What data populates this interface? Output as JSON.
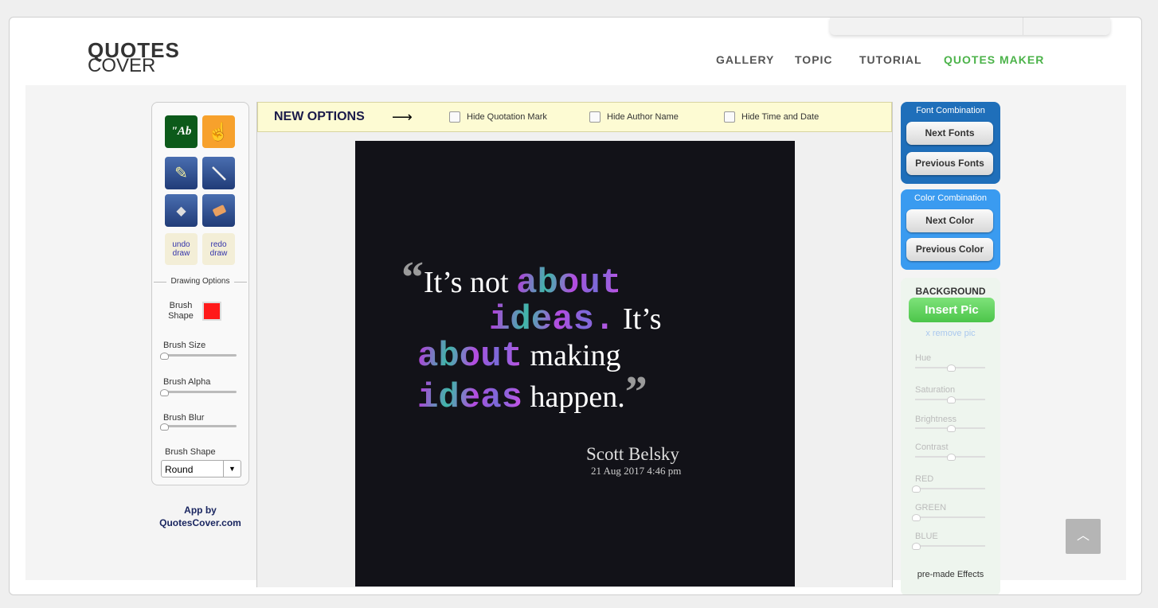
{
  "logo": {
    "line1": "QUOTES",
    "line2": "COVER"
  },
  "nav": [
    {
      "label": "GALLERY"
    },
    {
      "label": "TOPIC"
    },
    {
      "label": "TUTORIAL"
    },
    {
      "label": "QUOTES MAKER",
      "active": true
    }
  ],
  "tools": {
    "text_tool": "\"Ab",
    "undo": [
      "undo",
      "draw"
    ],
    "redo": [
      "redo",
      "draw"
    ]
  },
  "drawing": {
    "section": "Drawing Options",
    "brush_color_label": "Brush Shape",
    "brush_color": "#ff1a1a",
    "brush_size": "Brush Size",
    "brush_alpha": "Brush Alpha",
    "brush_blur": "Brush Blur",
    "brush_shape": "Brush Shape",
    "brush_shape_value": "Round"
  },
  "app_by": {
    "line1": "App by",
    "line2": "QuotesCover.com"
  },
  "options": {
    "title": "NEW OPTIONS",
    "hide_quote": "Hide Quotation Mark",
    "hide_author": "Hide Author Name",
    "hide_date": "Hide Time and Date"
  },
  "quote": {
    "open": "“",
    "close": "”",
    "seg1": "It’s not ",
    "w1": "about",
    "w2": "ideas.",
    "seg2": " It’s",
    "w3": "about",
    "seg3": " making",
    "w4": "ideas",
    "seg4": " happen.",
    "author": "Scott Belsky",
    "date": "21 Aug 2017 4:46 pm"
  },
  "fonts": {
    "title": "Font Combination",
    "next": "Next Fonts",
    "prev": "Previous Fonts"
  },
  "colors": {
    "title": "Color Combination",
    "next": "Next Color",
    "prev": "Previous Color"
  },
  "background": {
    "title": "BACKGROUND",
    "insert": "Insert Pic",
    "remove": "x remove pic",
    "filters": [
      "Hue",
      "Saturation",
      "Brightness",
      "Contrast",
      "RED",
      "GREEN",
      "BLUE"
    ],
    "effects": "pre-made Effects"
  },
  "accent": "#4cb34a"
}
